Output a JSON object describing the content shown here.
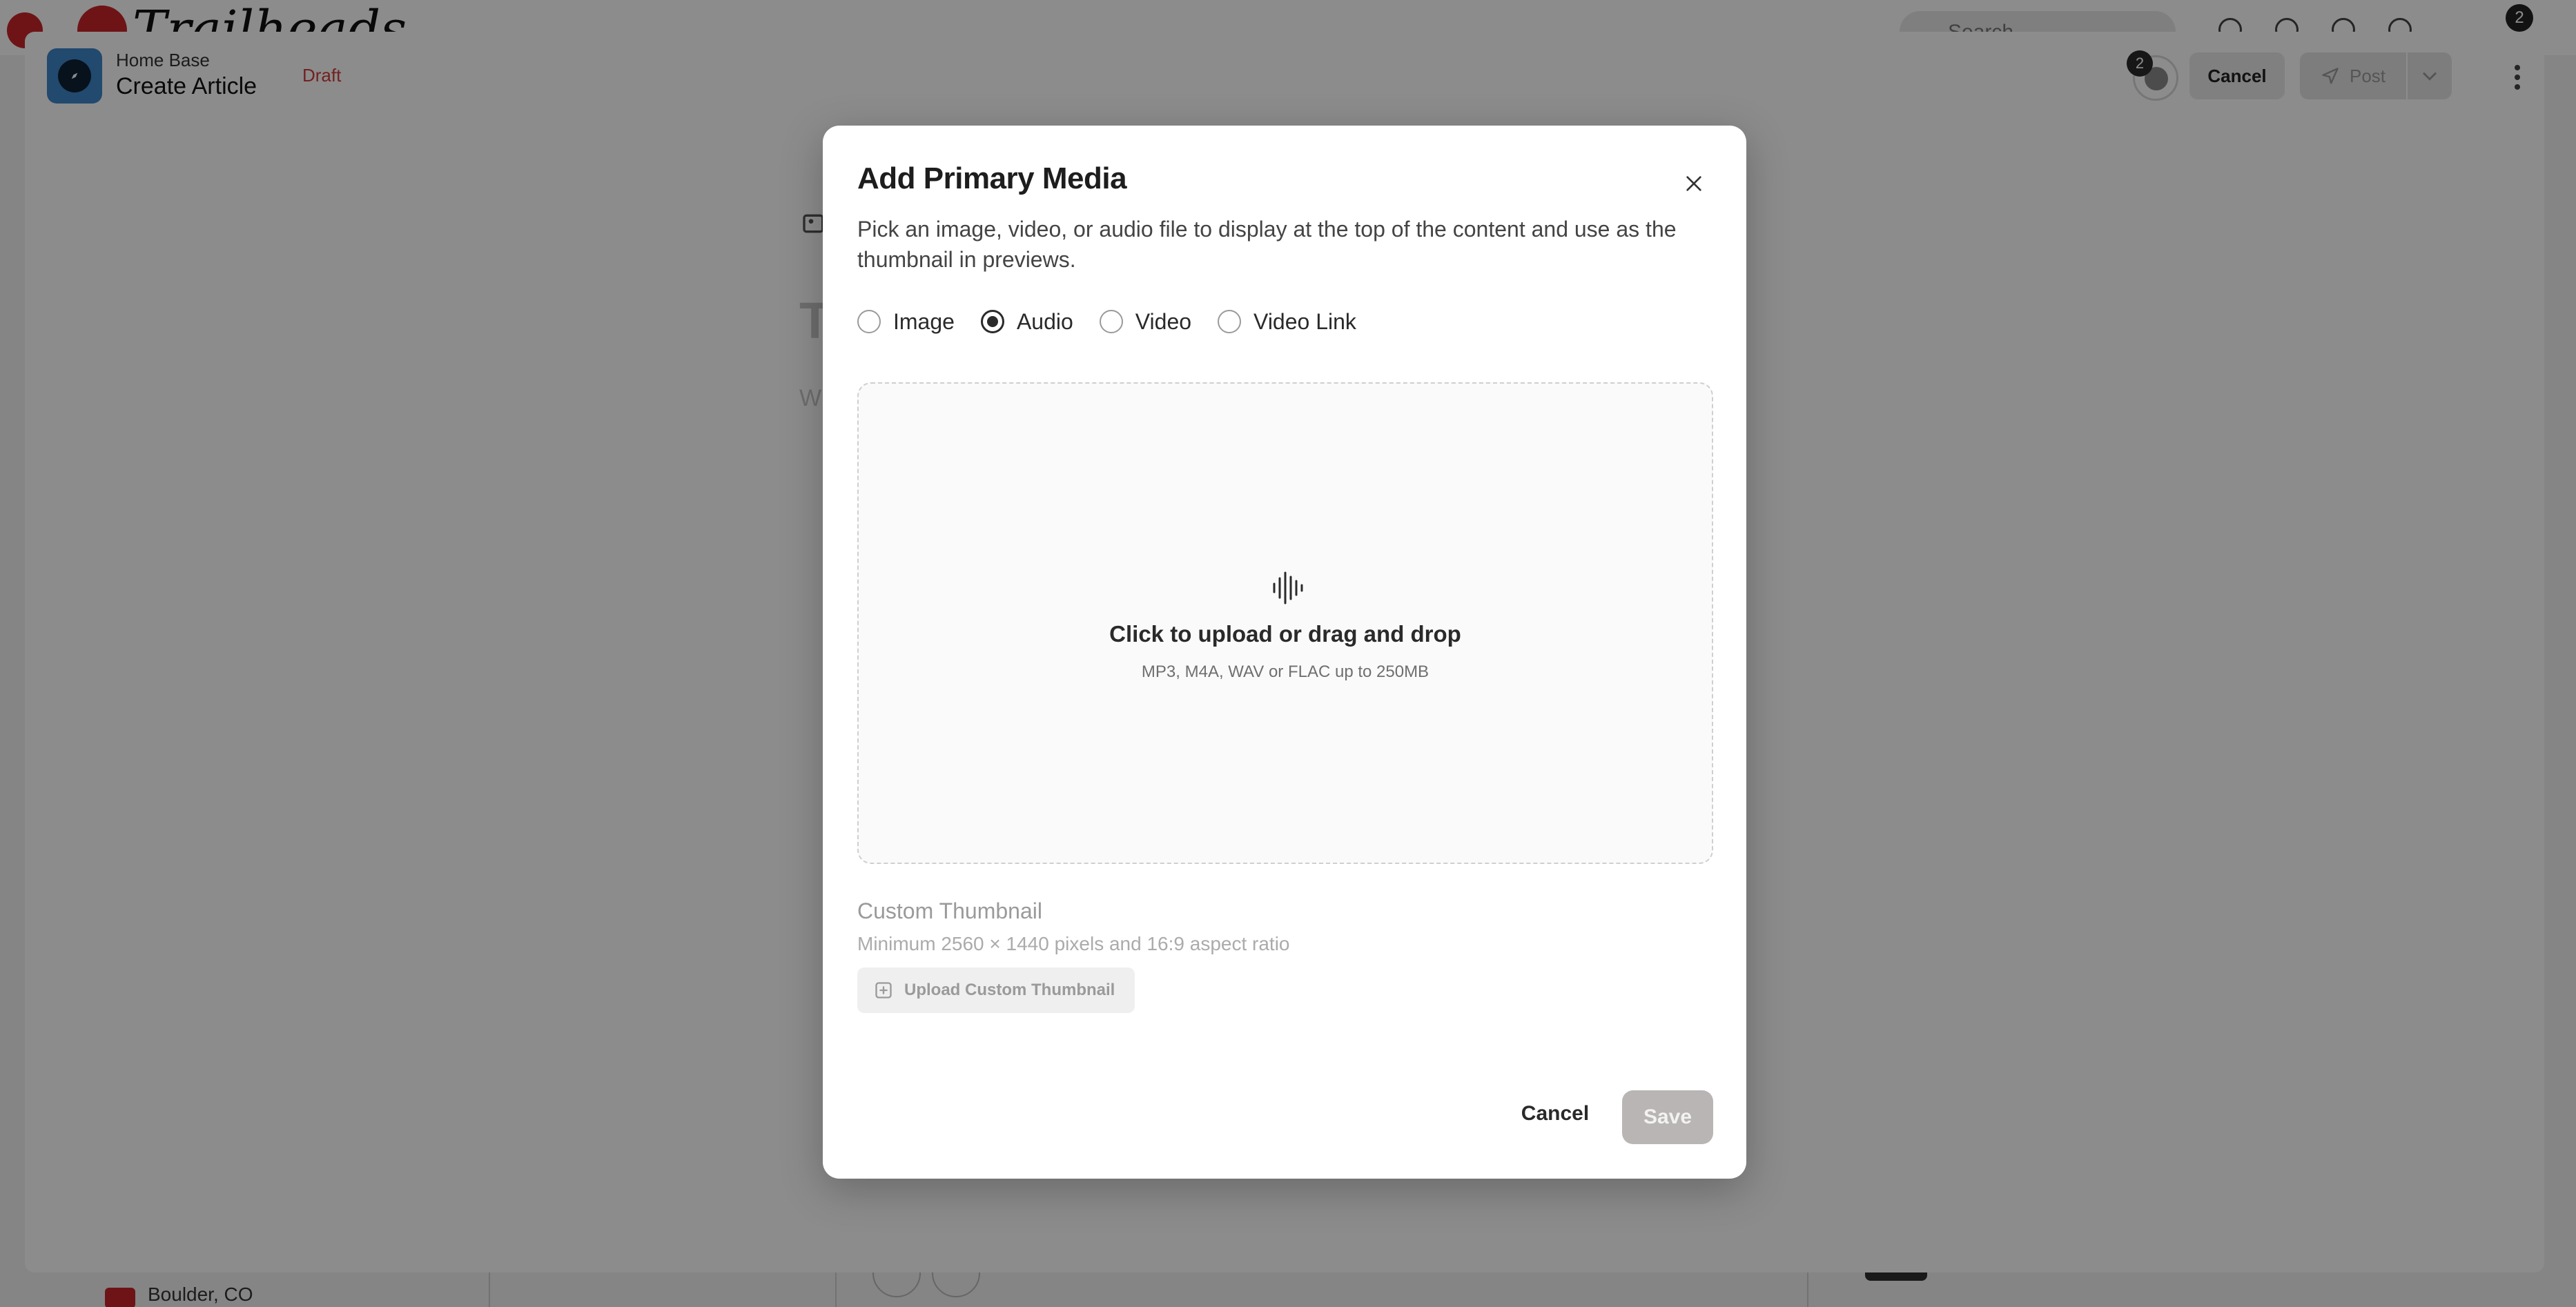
{
  "background": {
    "logo_text": "Trailheads",
    "search_placeholder": "Search",
    "notifications_count": "2",
    "bottom_location": "Boulder, CO"
  },
  "header": {
    "space_name": "Home Base",
    "page_title": "Create Article",
    "status": "Draft",
    "collaborators_count": "2",
    "cancel_label": "Cancel",
    "post_label": "Post"
  },
  "editor": {
    "title_placeholder": "T",
    "body_placeholder": "W"
  },
  "modal": {
    "title": "Add Primary Media",
    "description": "Pick an image, video, or audio file to display at the top of the content and use as the thumbnail in previews.",
    "media_types": [
      {
        "label": "Image",
        "selected": false
      },
      {
        "label": "Audio",
        "selected": true
      },
      {
        "label": "Video",
        "selected": false
      },
      {
        "label": "Video Link",
        "selected": false
      }
    ],
    "dropzone": {
      "icon": "audio-waveform-icon",
      "text": "Click to upload or drag and drop",
      "hint": "MP3, M4A, WAV or FLAC up to 250MB"
    },
    "custom_thumbnail": {
      "title": "Custom Thumbnail",
      "requirements": "Minimum 2560 × 1440 pixels and 16:9 aspect ratio",
      "upload_label": "Upload Custom Thumbnail"
    },
    "cancel_label": "Cancel",
    "save_label": "Save"
  },
  "colors": {
    "draft": "#d23b3b",
    "space_icon": "#3f86c8",
    "save_disabled": "#b9b5b5"
  }
}
